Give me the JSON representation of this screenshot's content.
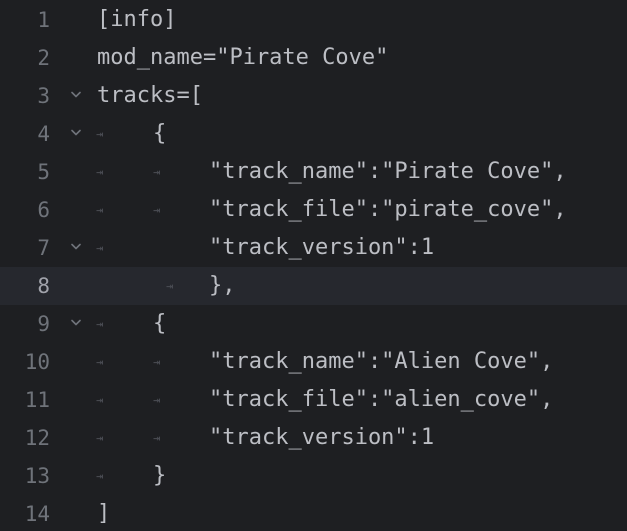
{
  "editor": {
    "current_line": 8,
    "tab_marker": "⇥",
    "lines": [
      {
        "n": "1",
        "text": "[info]"
      },
      {
        "n": "2",
        "text": "mod_name=\"Pirate Cove\""
      },
      {
        "n": "3",
        "text": "tracks=["
      },
      {
        "n": "4",
        "text": "{"
      },
      {
        "n": "5",
        "text": "\"track_name\":\"Pirate Cove\","
      },
      {
        "n": "6",
        "text": "\"track_file\":\"pirate_cove\","
      },
      {
        "n": "7",
        "text": "\"track_version\":1"
      },
      {
        "n": "8",
        "text": "},"
      },
      {
        "n": "9",
        "text": "{"
      },
      {
        "n": "10",
        "text": "\"track_name\":\"Alien Cove\","
      },
      {
        "n": "11",
        "text": "\"track_file\":\"alien_cove\","
      },
      {
        "n": "12",
        "text": "\"track_version\":1"
      },
      {
        "n": "13",
        "text": "}"
      },
      {
        "n": "14",
        "text": "]"
      }
    ]
  }
}
